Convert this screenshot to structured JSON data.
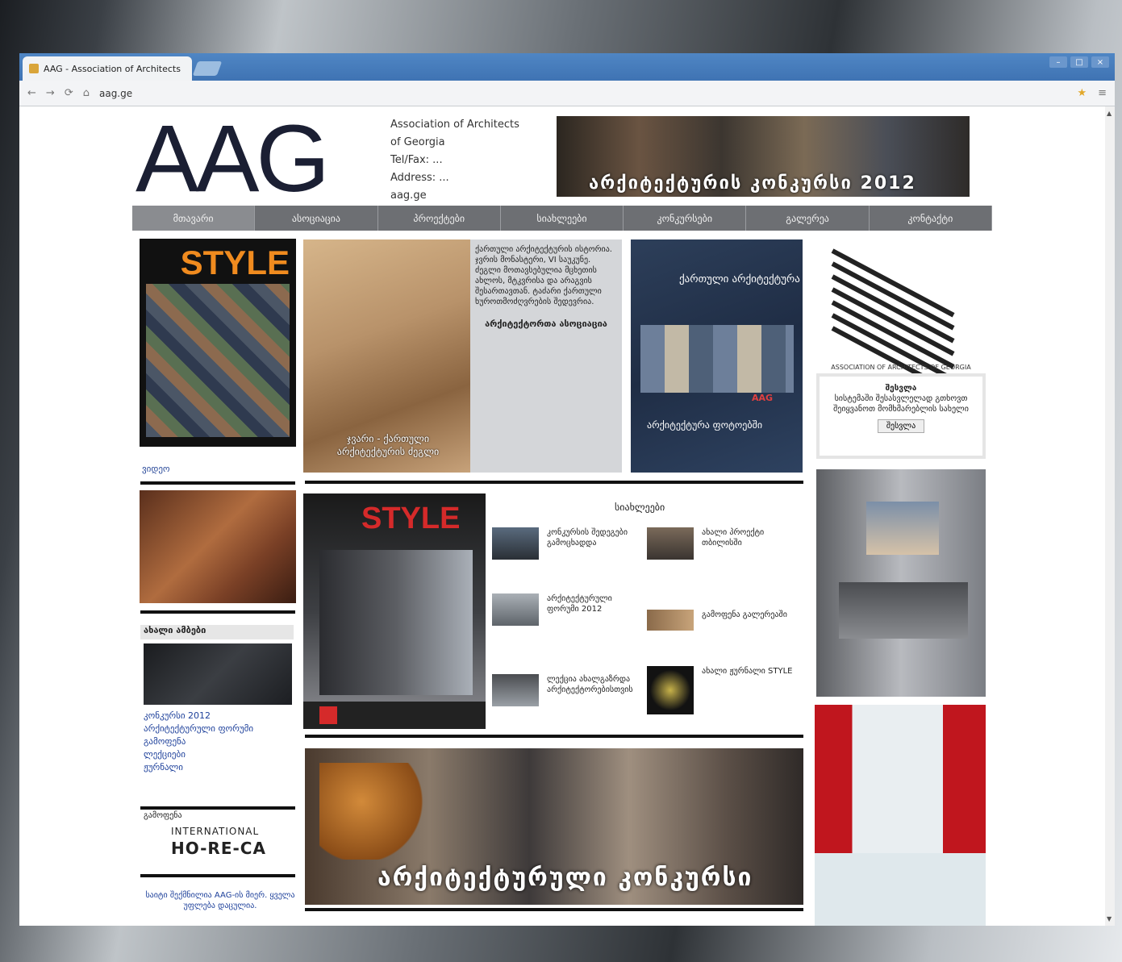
{
  "browser": {
    "tab_title": "AAG - Association of Architects",
    "url": "aag.ge",
    "nav_back": "←",
    "nav_forward": "→",
    "reload": "⟳",
    "home": "⌂",
    "star": "★",
    "menu": "≡",
    "win_min": "–",
    "win_max": "□",
    "win_close": "×"
  },
  "header": {
    "logo": "AAG",
    "address_lines": [
      "Association of Architects",
      "of Georgia",
      "Tel/Fax: ...",
      "Address: ...",
      "aag.ge"
    ],
    "banner_caption": "არქიტექტურის კონკურსი 2012"
  },
  "nav": {
    "items": [
      "მთავარი",
      "ასოციაცია",
      "პროექტები",
      "სიახლეები",
      "კონკურსები",
      "გალერეა",
      "კონტაქტი"
    ]
  },
  "left": {
    "style_title": "STYLE",
    "label": "ვიდეო",
    "box_title": "ახალი ამბები",
    "links": [
      "კონკურსი 2012",
      "არქიტექტურული ფორუმი",
      "გამოფენა",
      "ლექციები",
      "ჟურნალი"
    ],
    "horeca_small": "გამოფენა",
    "horeca_line1": "INTERNATIONAL",
    "horeca_line2": "HO-RE-CA",
    "foot_links": "საიტი შექმნილია AAG-ის მიერ. ყველა უფლება დაცულია."
  },
  "center": {
    "church_caption": "ჯვარი - ქართული არქიტექტურის ძეგლი",
    "church_text": "ქართული არქიტექტურის ისტორია. ჯვრის მონასტერი, VI საუკუნე. ძეგლი მოთავსებულია მცხეთის ახლოს, მტკვრისა და არაგვის შესართავთან. ტაძარი ქართული ხუროთმოძღვრების შედევრია.",
    "church_sign": "არქიტექტორთა ასოციაცია",
    "denim_text": "ქართული არქიტექტურა",
    "denim_red": "AAG",
    "denim_sub": "არქიტექტურა ფოტოებში",
    "style2_title": "STYLE",
    "news_head": "სიახლეები",
    "news": [
      "კონკურსის შედეგები გამოცხადდა",
      "ახალი პროექტი თბილისში",
      "არქიტექტურული ფორუმი 2012",
      "გამოფენა გალერეაში",
      "ლექცია ახალგაზრდა არქიტექტორებისთვის",
      "ახალი ჟურნალი STYLE"
    ],
    "crowd_caption": "არქიტექტურული კონკურსი"
  },
  "right": {
    "stripes_footer": "ASSOCIATION OF ARCHITECTS OF GEORGIA",
    "login_title": "შესვლა",
    "login_text": "სისტემაში შესასვლელად გთხოვთ შეიყვანოთ მომხმარებლის სახელი",
    "login_button": "შესვლა"
  }
}
